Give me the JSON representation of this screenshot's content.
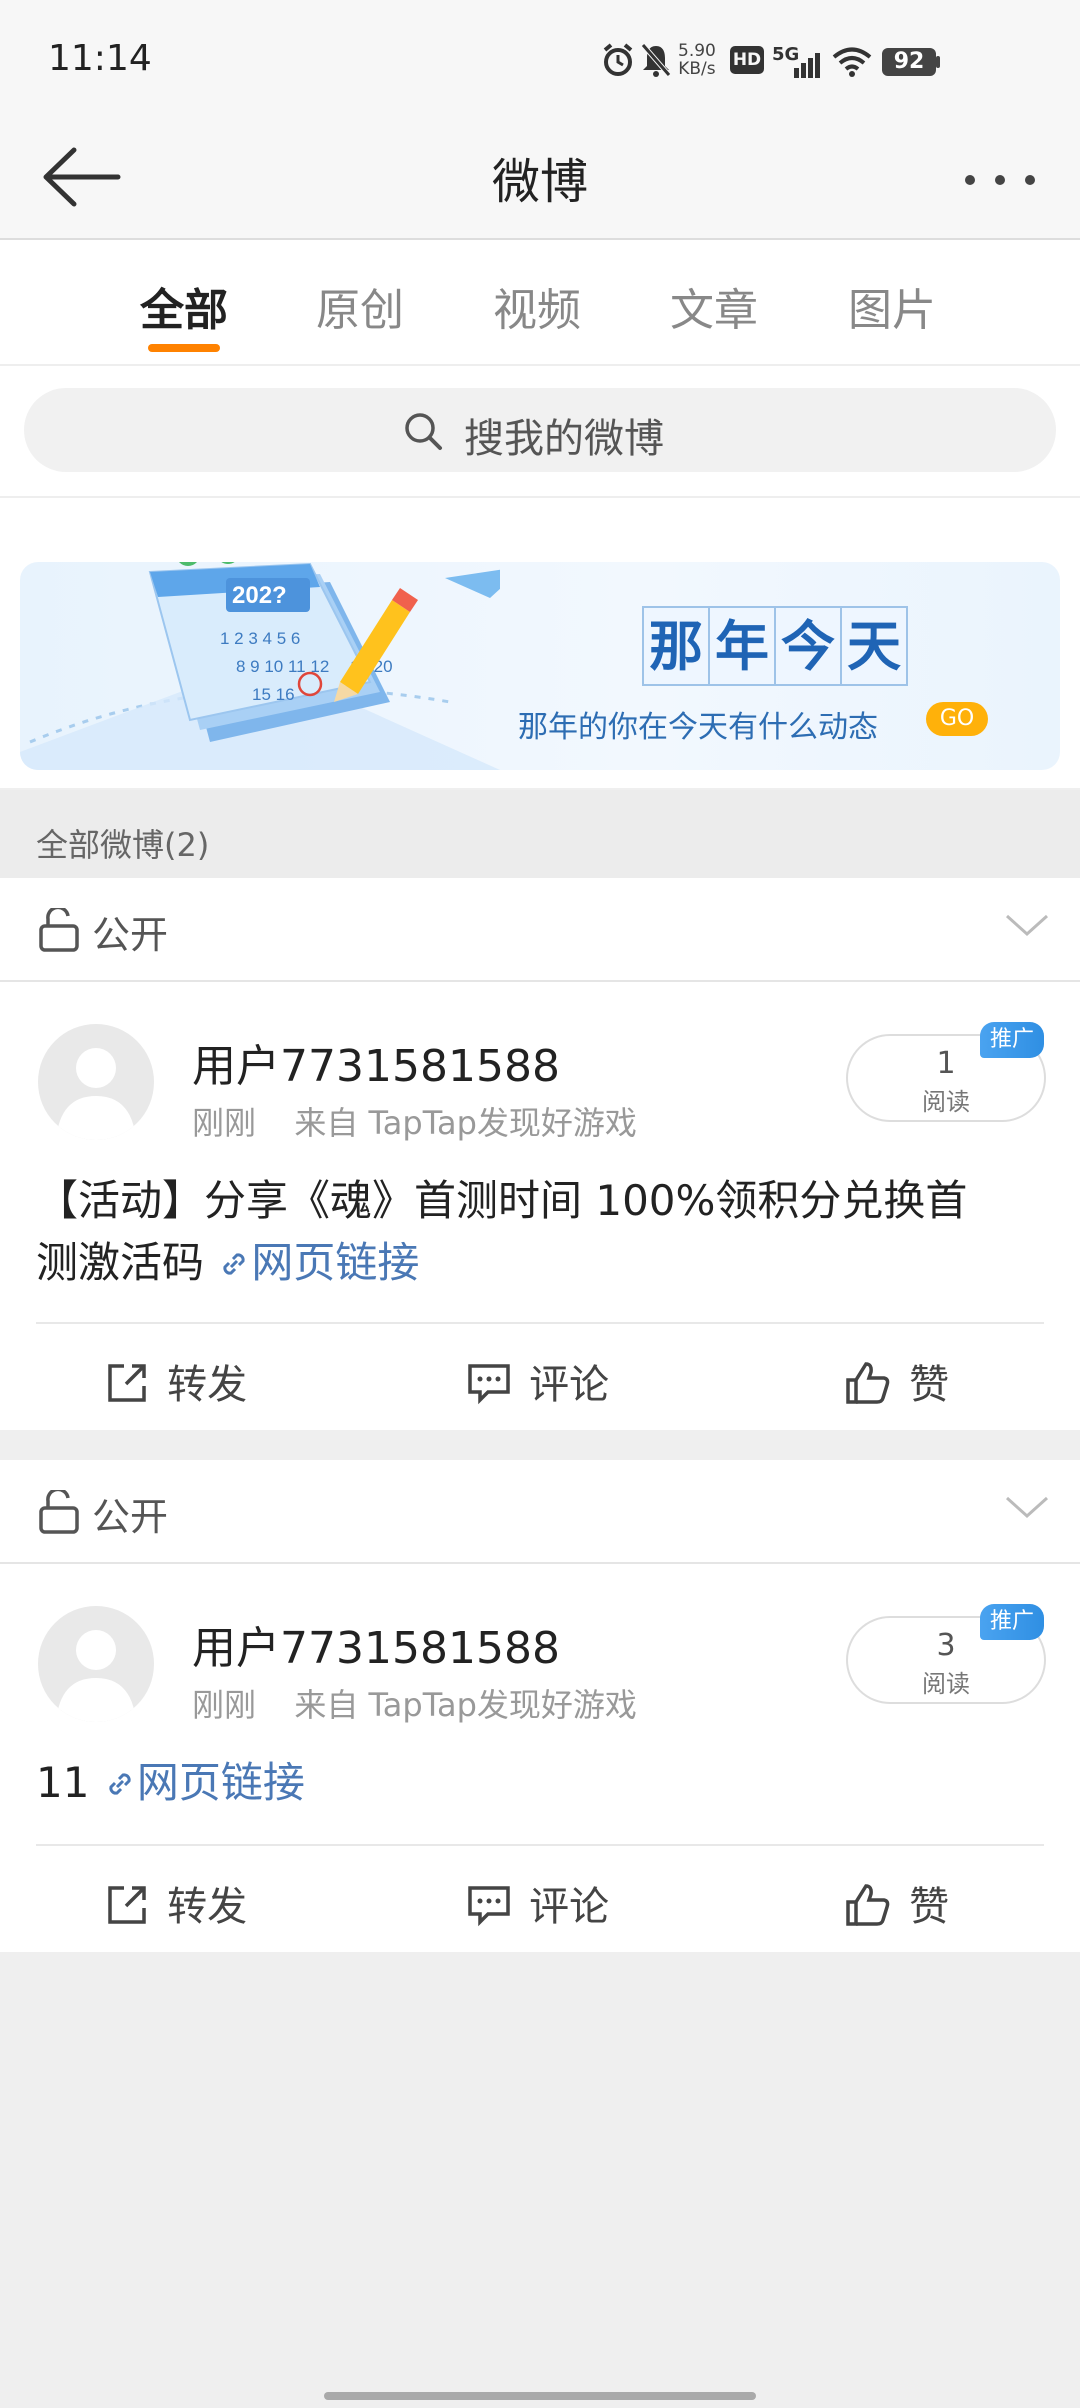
{
  "status_bar": {
    "time": "11:14",
    "net_speed_value": "5.90",
    "net_speed_unit": "KB/s",
    "hd_label": "HD",
    "network": "5G",
    "battery": "92"
  },
  "header": {
    "title": "微博"
  },
  "tabs": [
    {
      "label": "全部",
      "active": true
    },
    {
      "label": "原创",
      "active": false
    },
    {
      "label": "视频",
      "active": false
    },
    {
      "label": "文章",
      "active": false
    },
    {
      "label": "图片",
      "active": false
    }
  ],
  "search": {
    "placeholder": "搜我的微博"
  },
  "banner": {
    "calendar_year": "202?",
    "calendar_days": [
      "1 2 3 4 5 6",
      "8 9 10 11 12",
      "15 16",
      "19 20"
    ],
    "title_chars": [
      "那",
      "年",
      "今",
      "天"
    ],
    "subtitle": "那年的你在今天有什么动态",
    "go": "GO"
  },
  "section": {
    "label": "全部微博(2)"
  },
  "posts": [
    {
      "visibility": "公开",
      "username": "用户7731581588",
      "time": "刚刚",
      "source": "来自 TapTap发现好游戏",
      "reads": "1",
      "reads_label": "阅读",
      "promo": "推广",
      "text_line1": "【活动】分享《魂》首测时间 100%领积分兑换首",
      "text_line2": "测激活码",
      "link": "网页链接",
      "actions": {
        "repost": "转发",
        "comment": "评论",
        "like": "赞"
      }
    },
    {
      "visibility": "公开",
      "username": "用户7731581588",
      "time": "刚刚",
      "source": "来自 TapTap发现好游戏",
      "reads": "3",
      "reads_label": "阅读",
      "promo": "推广",
      "text_line1": "11",
      "link": "网页链接",
      "actions": {
        "repost": "转发",
        "comment": "评论",
        "like": "赞"
      }
    }
  ],
  "colors": {
    "accent": "#ff8200",
    "link": "#4a78b5",
    "promo": "#2f8fe3"
  }
}
